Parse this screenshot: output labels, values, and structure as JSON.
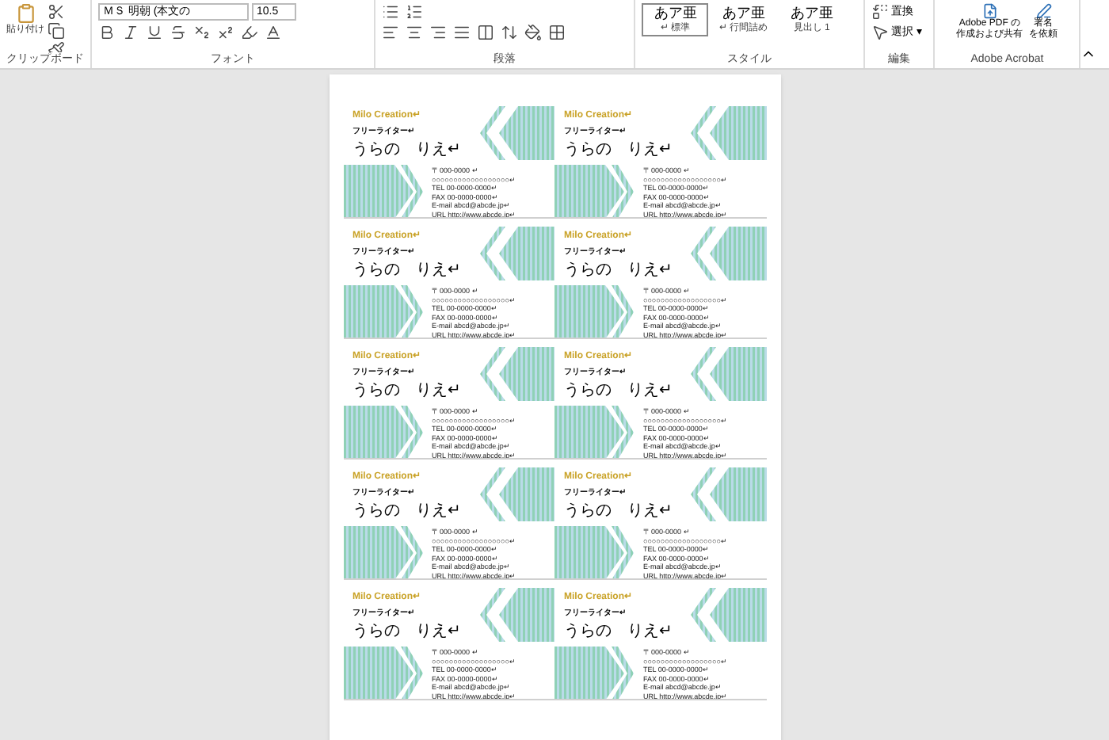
{
  "ribbon": {
    "clipboard": {
      "paste": "貼り付け",
      "label": "クリップボード"
    },
    "font": {
      "name": "ＭＳ 明朝 (本文の",
      "size": "10.5",
      "label": "フォント"
    },
    "paragraph": {
      "label": "段落"
    },
    "styles": {
      "items": [
        {
          "sample": "あア亜",
          "name": "↵ 標準",
          "selected": true
        },
        {
          "sample": "あア亜",
          "name": "↵ 行間詰め",
          "selected": false
        },
        {
          "sample": "あア亜",
          "name": "見出し 1",
          "selected": false
        }
      ],
      "label": "スタイル"
    },
    "editing": {
      "replace": "置換",
      "select": "選択 ▾",
      "label": "編集"
    },
    "acrobat": {
      "create": [
        "Adobe PDF の",
        "作成および共有"
      ],
      "sign": [
        "署名",
        "を依頼"
      ],
      "label": "Adobe Acrobat"
    }
  },
  "cards": [
    {
      "company": "Milo Creation↵",
      "role": "フリーライター↵",
      "name": "うらの　りえ↵",
      "lines": [
        "〒000-0000 ↵",
        "○○○○○○○○○○○○○○○○○○↵",
        "TEL 00-0000-0000↵",
        "FAX 00-0000-0000↵",
        "E-mail abcd@abcde.jp↵",
        "URL http://www.abcde.jp↵"
      ]
    },
    {
      "company": "Milo Creation↵",
      "role": "フリーライター↵",
      "name": "うらの　りえ↵",
      "lines": [
        "〒000-0000 ↵",
        "○○○○○○○○○○○○○○○○○○↵",
        "TEL 00-0000-0000↵",
        "FAX 00-0000-0000↵",
        "E-mail abcd@abcde.jp↵",
        "URL http://www.abcde.jp↵"
      ]
    },
    {
      "company": "Milo Creation↵",
      "role": "フリーライター↵",
      "name": "うらの　りえ↵",
      "lines": [
        "〒000-0000 ↵",
        "○○○○○○○○○○○○○○○○○○↵",
        "TEL 00-0000-0000↵",
        "FAX 00-0000-0000↵",
        "E-mail abcd@abcde.jp↵",
        "URL http://www.abcde.jp↵"
      ]
    },
    {
      "company": "Milo Creation↵",
      "role": "フリーライター↵",
      "name": "うらの　りえ↵",
      "lines": [
        "〒000-0000 ↵",
        "○○○○○○○○○○○○○○○○○○↵",
        "TEL 00-0000-0000↵",
        "FAX 00-0000-0000↵",
        "E-mail abcd@abcde.jp↵",
        "URL http://www.abcde.jp↵"
      ]
    },
    {
      "company": "Milo Creation↵",
      "role": "フリーライター↵",
      "name": "うらの　りえ↵",
      "lines": [
        "〒000-0000 ↵",
        "○○○○○○○○○○○○○○○○○○↵",
        "TEL 00-0000-0000↵",
        "FAX 00-0000-0000↵",
        "E-mail abcd@abcde.jp↵",
        "URL http://www.abcde.jp↵"
      ]
    },
    {
      "company": "Milo Creation↵",
      "role": "フリーライター↵",
      "name": "うらの　りえ↵",
      "lines": [
        "〒000-0000 ↵",
        "○○○○○○○○○○○○○○○○○○↵",
        "TEL 00-0000-0000↵",
        "FAX 00-0000-0000↵",
        "E-mail abcd@abcde.jp↵",
        "URL http://www.abcde.jp↵"
      ]
    },
    {
      "company": "Milo Creation↵",
      "role": "フリーライター↵",
      "name": "うらの　りえ↵",
      "lines": [
        "〒000-0000 ↵",
        "○○○○○○○○○○○○○○○○○○↵",
        "TEL 00-0000-0000↵",
        "FAX 00-0000-0000↵",
        "E-mail abcd@abcde.jp↵",
        "URL http://www.abcde.jp↵"
      ]
    },
    {
      "company": "Milo Creation↵",
      "role": "フリーライター↵",
      "name": "うらの　りえ↵",
      "lines": [
        "〒000-0000 ↵",
        "○○○○○○○○○○○○○○○○○○↵",
        "TEL 00-0000-0000↵",
        "FAX 00-0000-0000↵",
        "E-mail abcd@abcde.jp↵",
        "URL http://www.abcde.jp↵"
      ]
    },
    {
      "company": "Milo Creation↵",
      "role": "フリーライター↵",
      "name": "うらの　りえ↵",
      "lines": [
        "〒000-0000 ↵",
        "○○○○○○○○○○○○○○○○○○↵",
        "TEL 00-0000-0000↵",
        "FAX 00-0000-0000↵",
        "E-mail abcd@abcde.jp↵",
        "URL http://www.abcde.jp↵"
      ]
    },
    {
      "company": "Milo Creation↵",
      "role": "フリーライター↵",
      "name": "うらの　りえ↵",
      "lines": [
        "〒000-0000 ↵",
        "○○○○○○○○○○○○○○○○○○↵",
        "TEL 00-0000-0000↵",
        "FAX 00-0000-0000↵",
        "E-mail abcd@abcde.jp↵",
        "URL http://www.abcde.jp↵"
      ]
    }
  ]
}
